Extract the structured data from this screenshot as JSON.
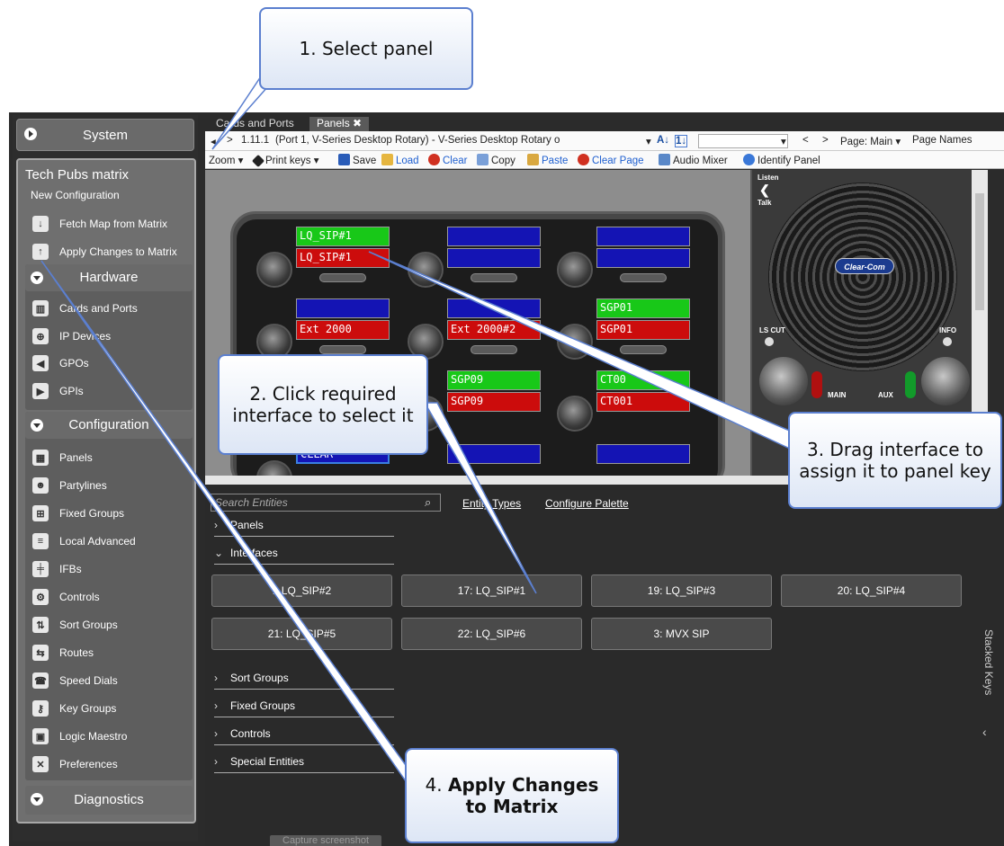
{
  "sidebar": {
    "system_label": "System",
    "matrix_title": "Tech Pubs matrix",
    "matrix_subtitle": "New Configuration",
    "actions": [
      {
        "label": "Fetch Map from Matrix"
      },
      {
        "label": "Apply Changes to Matrix"
      }
    ],
    "hardware": {
      "label": "Hardware",
      "items": [
        {
          "label": "Cards and Ports"
        },
        {
          "label": "IP Devices"
        },
        {
          "label": "GPOs"
        },
        {
          "label": "GPIs"
        }
      ]
    },
    "configuration": {
      "label": "Configuration",
      "items": [
        {
          "label": "Panels"
        },
        {
          "label": "Partylines"
        },
        {
          "label": "Fixed Groups"
        },
        {
          "label": "Local Advanced"
        },
        {
          "label": "IFBs"
        },
        {
          "label": "Controls"
        },
        {
          "label": "Sort Groups"
        },
        {
          "label": "Routes"
        },
        {
          "label": "Speed Dials"
        },
        {
          "label": "Key Groups"
        },
        {
          "label": "Logic Maestro"
        },
        {
          "label": "Preferences"
        }
      ]
    },
    "diagnostics_label": "Diagnostics"
  },
  "tabs": [
    {
      "label": "Cards and Ports"
    },
    {
      "label": "Panels"
    }
  ],
  "toolbar1": {
    "nav_sep": ">",
    "port": "1.11.1",
    "description": "(Port 1, V-Series Desktop Rotary)  -  V-Series Desktop Rotary o",
    "prev": "<",
    "next": ">",
    "page": "Page: Main",
    "page_names": "Page Names"
  },
  "toolbar2": {
    "zoom": "Zoom",
    "print_keys": "Print keys",
    "save": "Save",
    "load": "Load",
    "clear": "Clear",
    "copy": "Copy",
    "paste": "Paste",
    "clear_page": "Clear Page",
    "audio_mixer": "Audio Mixer",
    "identify_panel": "Identify Panel"
  },
  "panel_keys": [
    {
      "top": "LQ_SIP#1",
      "bottom": "LQ_SIP#1",
      "top_color": "green",
      "bottom_color": "red"
    },
    {
      "top": "",
      "bottom": "",
      "top_color": "blue",
      "bottom_color": "blue"
    },
    {
      "top": "",
      "bottom": "",
      "top_color": "blue",
      "bottom_color": "blue"
    },
    {
      "top": "",
      "bottom": "Ext 2000",
      "top_color": "blue",
      "bottom_color": "red"
    },
    {
      "top": "",
      "bottom": "Ext 2000#2",
      "top_color": "blue",
      "bottom_color": "red"
    },
    {
      "top": "SGP01",
      "bottom": "SGP01",
      "top_color": "green",
      "bottom_color": "red"
    },
    {
      "top": "SGP09",
      "bottom": "SGP09",
      "top_color": "green",
      "bottom_color": "red"
    },
    {
      "top": "CT00",
      "bottom": "CT001",
      "top_color": "green",
      "bottom_color": "red"
    },
    {
      "top": "CLEAR",
      "bottom": "",
      "top_color": "blue",
      "bottom_color": "blue"
    }
  ],
  "speaker": {
    "listen": "Listen",
    "talk": "Talk",
    "brand": "Clear-Com",
    "ls_cut": "LS CUT",
    "info": "INFO",
    "main": "MAIN",
    "aux": "AUX"
  },
  "entities": {
    "search_placeholder": "Search Entities",
    "entity_types": "Entity Types",
    "configure_palette": "Configure Palette",
    "sections": {
      "panels": "Panels",
      "interfaces": "Interfaces",
      "sort_groups": "Sort Groups",
      "fixed_groups": "Fixed Groups",
      "controls": "Controls",
      "special_entities": "Special Entities"
    },
    "interfaces": [
      {
        "label": "1 LQ_SIP#2"
      },
      {
        "label": "17: LQ_SIP#1"
      },
      {
        "label": "19: LQ_SIP#3"
      },
      {
        "label": "20: LQ_SIP#4"
      },
      {
        "label": "21: LQ_SIP#5"
      },
      {
        "label": "22: LQ_SIP#6"
      },
      {
        "label": "3: MVX SIP"
      }
    ],
    "stacked_keys": "Stacked Keys",
    "capture": "Capture screenshot"
  },
  "callouts": {
    "step1": "1. Select panel",
    "step2": "2. Click required interface to select it",
    "step3": "3. Drag interface to assign it to panel key",
    "step4_num": "4.",
    "step4_text": "Apply Changes to Matrix"
  },
  "colors": {
    "key_green": "#18c818",
    "key_red": "#cc0c0c",
    "key_blue": "#1414b4",
    "callout_border": "#5b7fcf"
  }
}
